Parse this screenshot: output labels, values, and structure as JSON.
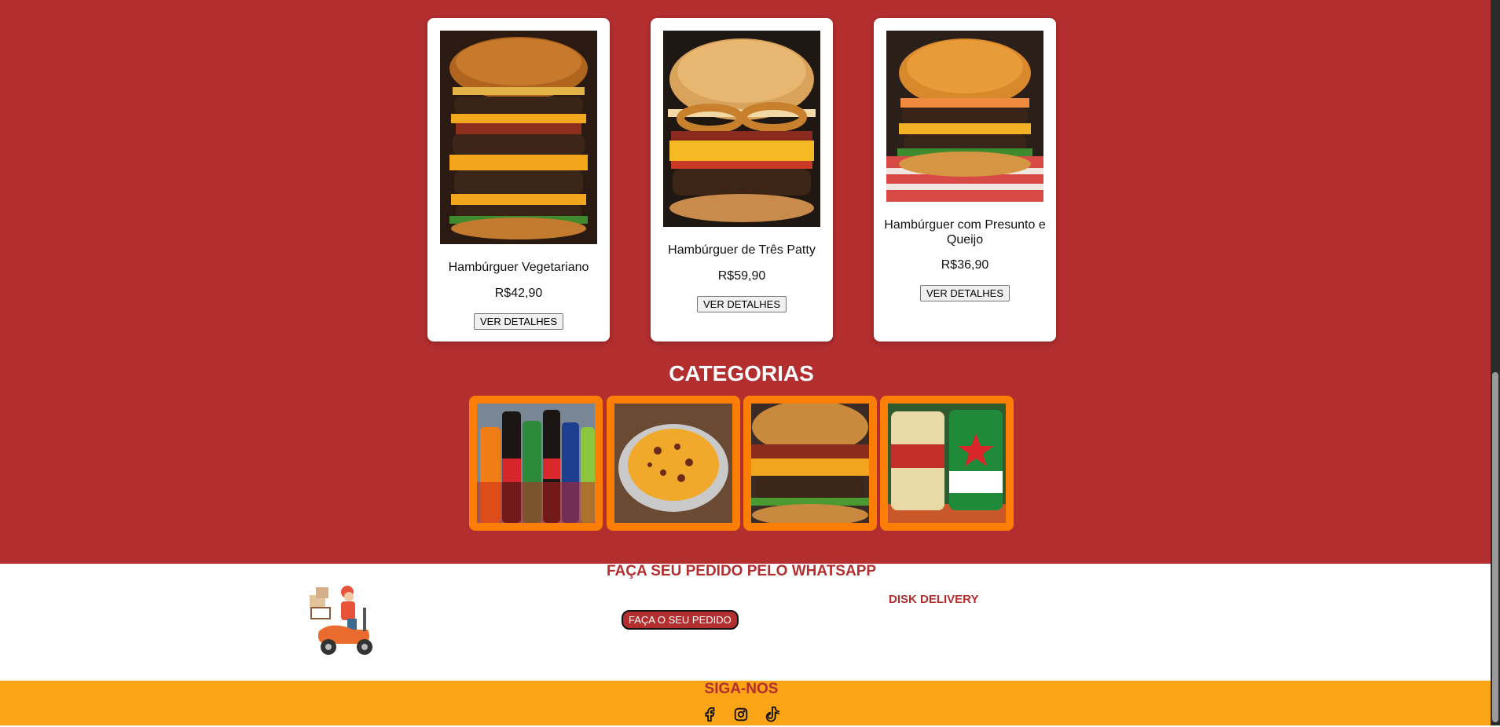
{
  "products": [
    {
      "name": "Hambúrguer Vegetariano",
      "price": "R$42,90",
      "button": "VER DETALHES",
      "image": "stacked-burger-photo"
    },
    {
      "name": "Hambúrguer de Três Patty",
      "price": "R$59,90",
      "button": "VER DETALHES",
      "image": "onion-ring-burger-photo"
    },
    {
      "name": "Hambúrguer com Presunto e Queijo",
      "price": "R$36,90",
      "button": "VER DETALHES",
      "image": "ham-cheese-burger-photo"
    }
  ],
  "categories": {
    "title": "CATEGORIAS",
    "items": [
      {
        "image": "soda-bottles-photo"
      },
      {
        "image": "cheese-fries-photo"
      },
      {
        "image": "bacon-burger-photo"
      },
      {
        "image": "beer-cans-photo"
      }
    ]
  },
  "whatsapp": {
    "title": "FAÇA SEU PEDIDO PELO WHATSAPP",
    "button": "FAÇA O SEU PEDIDO",
    "disk": "DISK DELIVERY",
    "illustration": "delivery-scooter-illustration"
  },
  "footer": {
    "title": "SIGA-NOS",
    "icons": [
      "facebook-icon",
      "instagram-icon",
      "tiktok-icon"
    ]
  },
  "colors": {
    "primary_red": "#b22e2f",
    "category_orange": "#fd7e05",
    "footer_orange": "#fba416",
    "white": "#ffffff"
  }
}
